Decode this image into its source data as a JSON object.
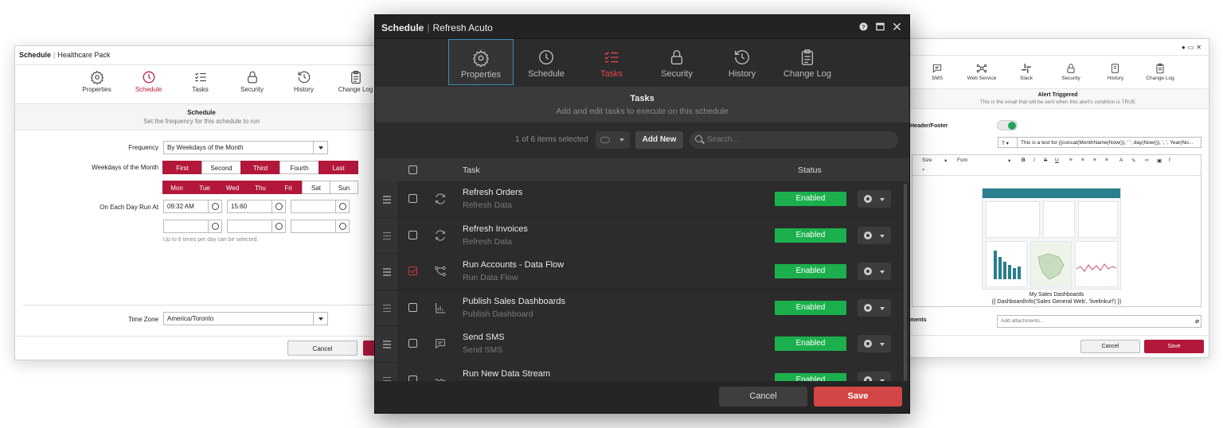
{
  "left_window": {
    "title_main": "Schedule",
    "title_sep": "|",
    "title_sub": "Healthcare Pack",
    "tabs": [
      {
        "label": "Properties",
        "icon": "gear-icon"
      },
      {
        "label": "Schedule",
        "icon": "clock-icon"
      },
      {
        "label": "Tasks",
        "icon": "tasks-icon"
      },
      {
        "label": "Security",
        "icon": "lock-icon"
      },
      {
        "label": "History",
        "icon": "history-icon"
      },
      {
        "label": "Change Log",
        "icon": "clipboard-icon"
      }
    ],
    "active_tab": "Schedule",
    "section_title": "Schedule",
    "section_subtitle": "Set the frequency for this schedule to run",
    "frequency_label": "Frequency",
    "frequency_value": "By Weekdays of the Month",
    "weekdays_label": "Weekdays of the Month",
    "weeks": [
      {
        "label": "First",
        "on": true
      },
      {
        "label": "Second",
        "on": false
      },
      {
        "label": "Third",
        "on": true
      },
      {
        "label": "Fourth",
        "on": false
      },
      {
        "label": "Last",
        "on": true
      }
    ],
    "days": [
      {
        "label": "Mon",
        "on": true
      },
      {
        "label": "Tue",
        "on": true
      },
      {
        "label": "Wed",
        "on": true
      },
      {
        "label": "Thu",
        "on": true
      },
      {
        "label": "Fri",
        "on": true
      },
      {
        "label": "Sat",
        "on": false
      },
      {
        "label": "Sun",
        "on": false
      }
    ],
    "run_at_label": "On Each Day Run At",
    "times": [
      "09:32 AM",
      "15:60",
      "",
      "",
      "",
      ""
    ],
    "times_hint": "Up to 6 times per day can be selected.",
    "timezone_label": "Time Zone",
    "timezone_value": "America/Toronto",
    "cancel_label": "Cancel",
    "accent": "#b3183b"
  },
  "right_window": {
    "tabs": [
      {
        "label": "SMS",
        "icon": "sms-icon"
      },
      {
        "label": "Web Service",
        "icon": "web-service-icon"
      },
      {
        "label": "Slack",
        "icon": "slack-icon"
      },
      {
        "label": "Security",
        "icon": "lock-icon"
      },
      {
        "label": "History",
        "icon": "history-icon"
      },
      {
        "label": "Change Log",
        "icon": "clipboard-icon"
      }
    ],
    "section_title": "Alert Triggered",
    "section_subtitle": "This is the email that will be sent when this alert's condition is TRUE",
    "header_footer_label": "Header/Footer",
    "subject_text": "This is a test for {{concat(MonthName(Now()), ' ', day(Now()), ', ', Year(No...",
    "toolbar_size": "Size",
    "toolbar_font": "Font",
    "dashboard_caption_1": "My Sales Dashboards",
    "dashboard_caption_2": "{{ DashboardInfo('Sales General Web', 'livelinkurl') }}",
    "attachments_label": "ments",
    "attachments_placeholder": "Add attachments...",
    "cancel_label": "Cancel",
    "save_label": "Save"
  },
  "center_window": {
    "title_main": "Schedule",
    "title_sep": "|",
    "title_sub": "Refresh Acuto",
    "tabs": [
      {
        "label": "Properties",
        "icon": "gear-icon"
      },
      {
        "label": "Schedule",
        "icon": "clock-icon"
      },
      {
        "label": "Tasks",
        "icon": "tasks-icon"
      },
      {
        "label": "Security",
        "icon": "lock-icon"
      },
      {
        "label": "History",
        "icon": "history-icon"
      },
      {
        "label": "Change Log",
        "icon": "clipboard-icon"
      }
    ],
    "active_tab": "Tasks",
    "focused_tab": "Properties",
    "section_title": "Tasks",
    "section_subtitle": "Add and edit tasks to execute on this schedule",
    "selection_count": "1 of 6 items selected",
    "add_new_label": "Add New",
    "search_placeholder": "Search...",
    "col_task": "Task",
    "col_status": "Status",
    "rows": [
      {
        "name": "Refresh Orders",
        "type": "Refresh Data",
        "icon": "refresh-icon",
        "status": "Enabled",
        "checked": false
      },
      {
        "name": "Refresh Invoices",
        "type": "Refresh Data",
        "icon": "refresh-icon",
        "status": "Enabled",
        "checked": false
      },
      {
        "name": "Run Accounts - Data Flow",
        "type": "Run Data Flow",
        "icon": "data-flow-icon",
        "status": "Enabled",
        "checked": true
      },
      {
        "name": "Publish Sales Dashboards",
        "type": "Publish Dashboard",
        "icon": "chart-icon",
        "status": "Enabled",
        "checked": false
      },
      {
        "name": "Send SMS",
        "type": "Send SMS",
        "icon": "sms-icon",
        "status": "Enabled",
        "checked": false
      },
      {
        "name": "Run New Data Stream",
        "type": "",
        "icon": "data-stream-icon",
        "status": "Enabled",
        "checked": false
      }
    ],
    "cancel_label": "Cancel",
    "save_label": "Save",
    "accent_red": "#d44545",
    "status_green": "#1bb04d"
  }
}
